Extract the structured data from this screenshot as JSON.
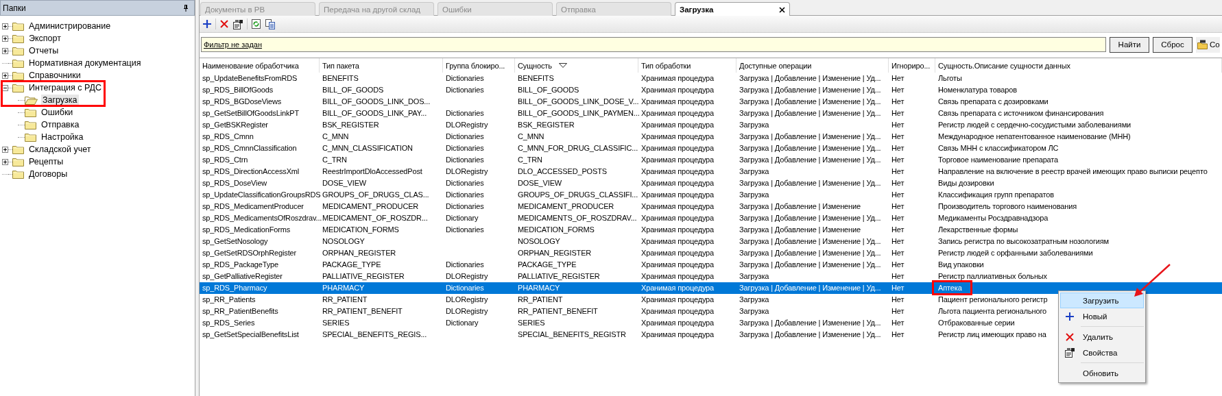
{
  "sidebar": {
    "title": "Папки",
    "tree": [
      {
        "label": "Администрирование",
        "kind": "branch",
        "expanded": false,
        "selected": false,
        "highlighted": false
      },
      {
        "label": "Экспорт",
        "kind": "branch",
        "expanded": false,
        "selected": false,
        "highlighted": false
      },
      {
        "label": "Отчеты",
        "kind": "branch",
        "expanded": false,
        "selected": false,
        "highlighted": false
      },
      {
        "label": "Нормативная документация",
        "kind": "leaf",
        "selected": false,
        "highlighted": false
      },
      {
        "label": "Справочники",
        "kind": "branch",
        "expanded": false,
        "selected": false,
        "highlighted": false
      },
      {
        "label": "Интеграция с РДС",
        "kind": "branch",
        "expanded": true,
        "selected": false,
        "highlighted": true,
        "children": [
          {
            "label": "Загрузка",
            "selected": true
          },
          {
            "label": "Ошибки",
            "selected": false
          },
          {
            "label": "Отправка",
            "selected": false
          },
          {
            "label": "Настройка",
            "selected": false
          }
        ]
      },
      {
        "label": "Складской учет",
        "kind": "branch",
        "expanded": false,
        "selected": false,
        "highlighted": false
      },
      {
        "label": "Рецепты",
        "kind": "branch",
        "expanded": false,
        "selected": false,
        "highlighted": false
      },
      {
        "label": "Договоры",
        "kind": "leaf",
        "selected": false,
        "highlighted": false
      }
    ]
  },
  "tabs": [
    {
      "label": "Документы в РВ",
      "selected": false
    },
    {
      "label": "Передача на другой склад",
      "selected": false
    },
    {
      "label": "Ошибки",
      "selected": false
    },
    {
      "label": "Отправка",
      "selected": false
    },
    {
      "label": "Загрузка",
      "selected": true
    }
  ],
  "filter": {
    "link": "Фильтр не задан",
    "buttons": [
      "Найти",
      "Сброс"
    ],
    "third_button": "Со"
  },
  "table": {
    "columns": [
      {
        "label": "Наименование обработчика",
        "sorted": false
      },
      {
        "label": "Тип пакета",
        "sorted": false
      },
      {
        "label": "Группа блокиро...",
        "sorted": false
      },
      {
        "label": "Сущность",
        "sorted": true
      },
      {
        "label": "Тип обработки",
        "sorted": false
      },
      {
        "label": "Доступные операции",
        "sorted": false
      },
      {
        "label": "Игнориро...",
        "sorted": false
      },
      {
        "label": "Сущность.Описание сущности данных",
        "sorted": false
      }
    ],
    "rows": [
      {
        "cells": [
          "sp_UpdateBenefitsFromRDS",
          "BENEFITS",
          "Dictionaries",
          "BENEFITS",
          "Хранимая процедура",
          "Загрузка | Добавление | Изменение | Уд...",
          "Нет",
          "Льготы"
        ],
        "selected": false,
        "highlighted": false
      },
      {
        "cells": [
          "sp_RDS_BillOfGoods",
          "BILL_OF_GOODS",
          "Dictionaries",
          "BILL_OF_GOODS",
          "Хранимая процедура",
          "Загрузка | Добавление | Изменение | Уд...",
          "Нет",
          "Номенклатура товаров"
        ],
        "selected": false,
        "highlighted": false
      },
      {
        "cells": [
          "sp_RDS_BGDoseViews",
          "BILL_OF_GOODS_LINK_DOS...",
          null,
          "BILL_OF_GOODS_LINK_DOSE_V...",
          "Хранимая процедура",
          "Загрузка | Добавление | Изменение | Уд...",
          "Нет",
          "Связь препарата с дозировками"
        ],
        "selected": false,
        "highlighted": false
      },
      {
        "cells": [
          "sp_GetSetBillOfGoodsLinkPT",
          "BILL_OF_GOODS_LINK_PAY...",
          "Dictionaries",
          "BILL_OF_GOODS_LINK_PAYMEN...",
          "Хранимая процедура",
          "Загрузка | Добавление | Изменение | Уд...",
          "Нет",
          "Связь препарата с источником финансирования"
        ],
        "selected": false,
        "highlighted": false
      },
      {
        "cells": [
          "sp_GetBSKRegister",
          "BSK_REGISTER",
          "DLORegistry",
          "BSK_REGISTER",
          "Хранимая процедура",
          "Загрузка",
          "Нет",
          "Регистр людей с сердечно-сосудистыми заболеваниями"
        ],
        "selected": false,
        "highlighted": false
      },
      {
        "cells": [
          "sp_RDS_Cmnn",
          "C_MNN",
          "Dictionaries",
          "C_MNN",
          "Хранимая процедура",
          "Загрузка | Добавление | Изменение | Уд...",
          "Нет",
          "Международное непатентованное наименование (МНН)"
        ],
        "selected": false,
        "highlighted": false
      },
      {
        "cells": [
          "sp_RDS_CmnnClassification",
          "C_MNN_CLASSIFICATION",
          "Dictionaries",
          "C_MNN_FOR_DRUG_CLASSIFIC...",
          "Хранимая процедура",
          "Загрузка | Добавление | Изменение | Уд...",
          "Нет",
          "Связь МНН с классификатором ЛС"
        ],
        "selected": false,
        "highlighted": false
      },
      {
        "cells": [
          "sp_RDS_Ctrn",
          "C_TRN",
          "Dictionaries",
          "C_TRN",
          "Хранимая процедура",
          "Загрузка | Добавление | Изменение | Уд...",
          "Нет",
          "Торговое наименование препарата"
        ],
        "selected": false,
        "highlighted": false
      },
      {
        "cells": [
          "sp_RDS_DirectionAccessXml",
          "ReestrImportDloAccessedPost",
          "DLORegistry",
          "DLO_ACCESSED_POSTS",
          "Хранимая процедура",
          "Загрузка",
          "Нет",
          "Направление на включение в реестр врачей имеющих право выписки рецепто"
        ],
        "selected": false,
        "highlighted": false
      },
      {
        "cells": [
          "sp_RDS_DoseView",
          "DOSE_VIEW",
          "Dictionaries",
          "DOSE_VIEW",
          "Хранимая процедура",
          "Загрузка | Добавление | Изменение | Уд...",
          "Нет",
          "Виды дозировки"
        ],
        "selected": false,
        "highlighted": false
      },
      {
        "cells": [
          "sp_UpdateClassificationGroupsRDS",
          "GROUPS_OF_DRUGS_CLAS...",
          "Dictionaries",
          "GROUPS_OF_DRUGS_CLASSIFI...",
          "Хранимая процедура",
          "Загрузка",
          "Нет",
          "Классификация групп препаратов"
        ],
        "selected": false,
        "highlighted": false
      },
      {
        "cells": [
          "sp_RDS_MedicamentProducer",
          "MEDICAMENT_PRODUCER",
          "Dictionaries",
          "MEDICAMENT_PRODUCER",
          "Хранимая процедура",
          "Загрузка | Добавление | Изменение",
          "Нет",
          "Производитель торгового наименования"
        ],
        "selected": false,
        "highlighted": false
      },
      {
        "cells": [
          "sp_RDS_MedicamentsOfRoszdrav...",
          "MEDICAMENT_OF_ROSZDR...",
          "Dictionary",
          "MEDICAMENTS_OF_ROSZDRAV...",
          "Хранимая процедура",
          "Загрузка | Добавление | Изменение | Уд...",
          "Нет",
          "Медикаменты Росздравнадзора"
        ],
        "selected": false,
        "highlighted": false
      },
      {
        "cells": [
          "sp_RDS_MedicationForms",
          "MEDICATION_FORMS",
          "Dictionaries",
          "MEDICATION_FORMS",
          "Хранимая процедура",
          "Загрузка | Добавление | Изменение",
          "Нет",
          "Лекарственные формы"
        ],
        "selected": false,
        "highlighted": false
      },
      {
        "cells": [
          "sp_GetSetNosology",
          "NOSOLOGY",
          null,
          "NOSOLOGY",
          "Хранимая процедура",
          "Загрузка | Добавление | Изменение | Уд...",
          "Нет",
          "Запись регистра по высокозатратным нозологиям"
        ],
        "selected": false,
        "highlighted": false
      },
      {
        "cells": [
          "sp_GetSetRDSOrphRegister",
          "ORPHAN_REGISTER",
          null,
          "ORPHAN_REGISTER",
          "Хранимая процедура",
          "Загрузка | Добавление | Изменение | Уд...",
          "Нет",
          "Регистр людей с орфанными заболеваниями"
        ],
        "selected": false,
        "highlighted": false
      },
      {
        "cells": [
          "sp_RDS_PackageType",
          "PACKAGE_TYPE",
          "Dictionaries",
          "PACKAGE_TYPE",
          "Хранимая процедура",
          "Загрузка | Добавление | Изменение | Уд...",
          "Нет",
          "Вид упаковки"
        ],
        "selected": false,
        "highlighted": false
      },
      {
        "cells": [
          "sp_GetPalliativeRegister",
          "PALLIATIVE_REGISTER",
          "DLORegistry",
          "PALLIATIVE_REGISTER",
          "Хранимая процедура",
          "Загрузка",
          "Нет",
          "Регистр паллиативных больных"
        ],
        "selected": false,
        "highlighted": false
      },
      {
        "cells": [
          "sp_RDS_Pharmacy",
          "PHARMACY",
          "Dictionaries",
          "PHARMACY",
          "Хранимая процедура",
          "Загрузка | Добавление | Изменение | Уд...",
          "Нет",
          "Аптека"
        ],
        "selected": true,
        "highlighted": true
      },
      {
        "cells": [
          "sp_RR_Patients",
          "RR_PATIENT",
          "DLORegistry",
          "RR_PATIENT",
          "Хранимая процедура",
          "Загрузка",
          "Нет",
          "Пациент регионального регистр"
        ],
        "selected": false,
        "highlighted": false
      },
      {
        "cells": [
          "sp_RR_PatientBenefits",
          "RR_PATIENT_BENEFIT",
          "DLORegistry",
          "RR_PATIENT_BENEFIT",
          "Хранимая процедура",
          "Загрузка",
          "Нет",
          "Льгота пациента регионального"
        ],
        "selected": false,
        "highlighted": false
      },
      {
        "cells": [
          "sp_RDS_Series",
          "SERIES",
          "Dictionary",
          "SERIES",
          "Хранимая процедура",
          "Загрузка | Добавление | Изменение | Уд...",
          "Нет",
          "Отбракованные серии"
        ],
        "selected": false,
        "highlighted": false
      },
      {
        "cells": [
          "sp_GetSetSpecialBenefitsList",
          "SPECIAL_BENEFITS_REGIS...",
          null,
          "SPECIAL_BENEFITS_REGISTR",
          "Хранимая процедура",
          "Загрузка | Добавление | Изменение | Уд...",
          "Нет",
          "Регистр лиц имеющих право на"
        ],
        "selected": false,
        "highlighted": false
      }
    ]
  },
  "context_menu": {
    "items": [
      {
        "kind": "item",
        "label": "Загрузить",
        "selected": true,
        "pointed": true
      },
      {
        "kind": "item",
        "label": "Новый",
        "selected": false,
        "pointed": false
      },
      {
        "kind": "separator"
      },
      {
        "kind": "item",
        "label": "Удалить",
        "selected": false,
        "pointed": false
      },
      {
        "kind": "item",
        "label": "Свойства",
        "selected": false,
        "pointed": false
      },
      {
        "kind": "separator"
      },
      {
        "kind": "item",
        "label": "Обновить",
        "selected": false,
        "pointed": false
      }
    ]
  }
}
